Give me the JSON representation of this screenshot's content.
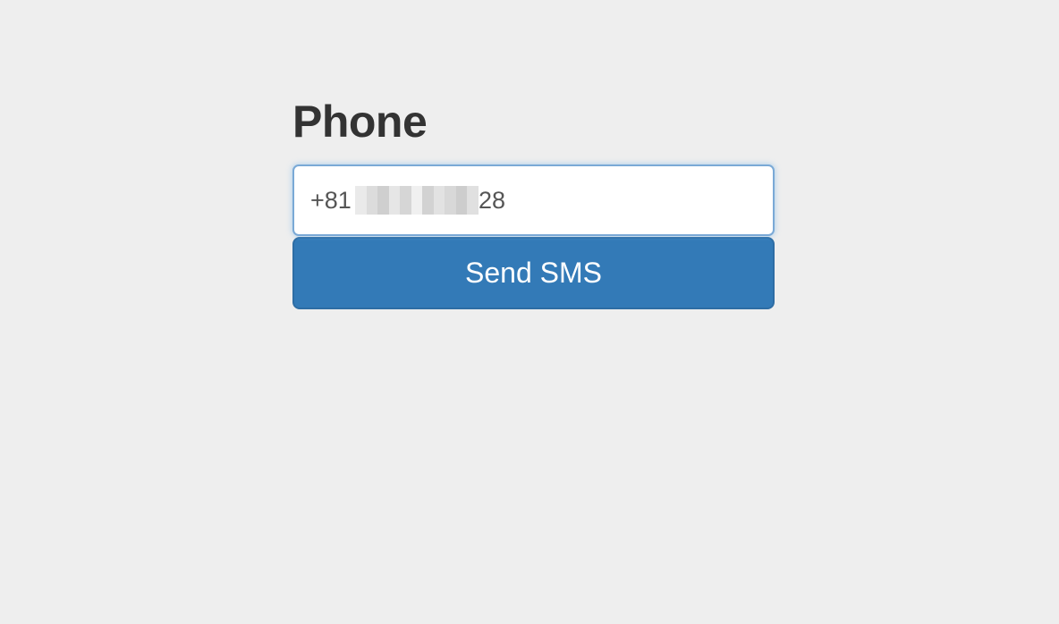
{
  "form": {
    "title": "Phone",
    "phone_value": "+81",
    "phone_suffix": "28",
    "send_label": "Send SMS"
  },
  "colors": {
    "page_background": "#eeeeee",
    "button_primary": "#337ab7",
    "input_focus_border": "#7aa9d6"
  }
}
